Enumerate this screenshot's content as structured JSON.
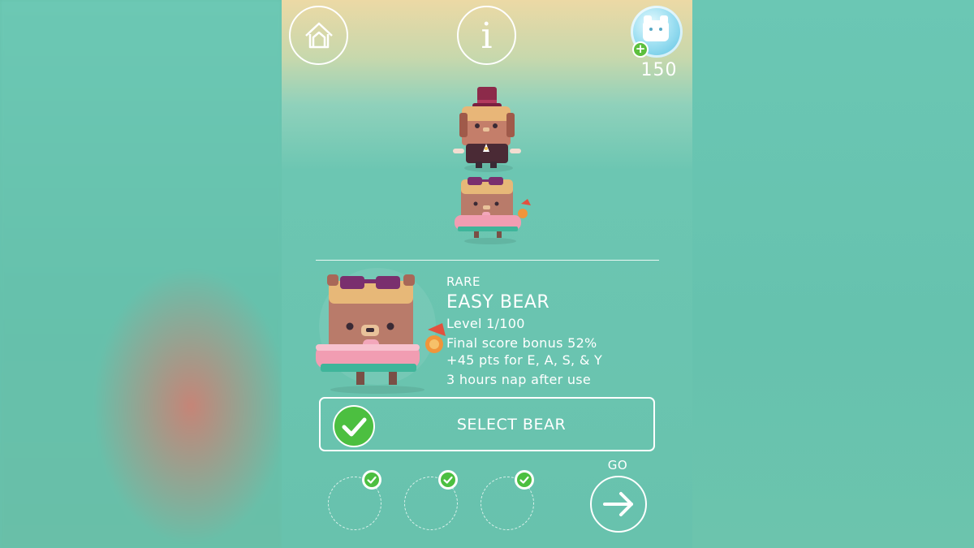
{
  "top_bar": {
    "home_button": "home-icon",
    "info_button": "i",
    "currency": {
      "icon": "bear-coin-icon",
      "add_icon": "+",
      "amount": "150"
    }
  },
  "bear_stack": [
    {
      "name": "gentleman-bear",
      "accessory": "top-hat"
    },
    {
      "name": "easy-bear",
      "accessory": "sunglasses-and-drink"
    }
  ],
  "bear_details": {
    "rarity": "RARE",
    "name": "EASY BEAR",
    "level": "Level 1/100",
    "bonus": "Final score bonus 52%",
    "points": "+45 pts for E, A, S, & Y",
    "nap": "3 hours nap after use"
  },
  "select_button": {
    "label": "SELECT BEAR",
    "checked": true
  },
  "slots": [
    {
      "checked": true
    },
    {
      "checked": true
    },
    {
      "checked": true
    }
  ],
  "go_button": {
    "label": "GO",
    "icon": "arrow-right-icon"
  },
  "colors": {
    "background": "#67c2ad",
    "sand": "#ecd9a5",
    "check_green": "#4cbf40",
    "bear_brown": "#b97b6a",
    "bear_tan": "#e7b878",
    "float_pink": "#f19db2",
    "sunglasses": "#7a2f6e"
  }
}
